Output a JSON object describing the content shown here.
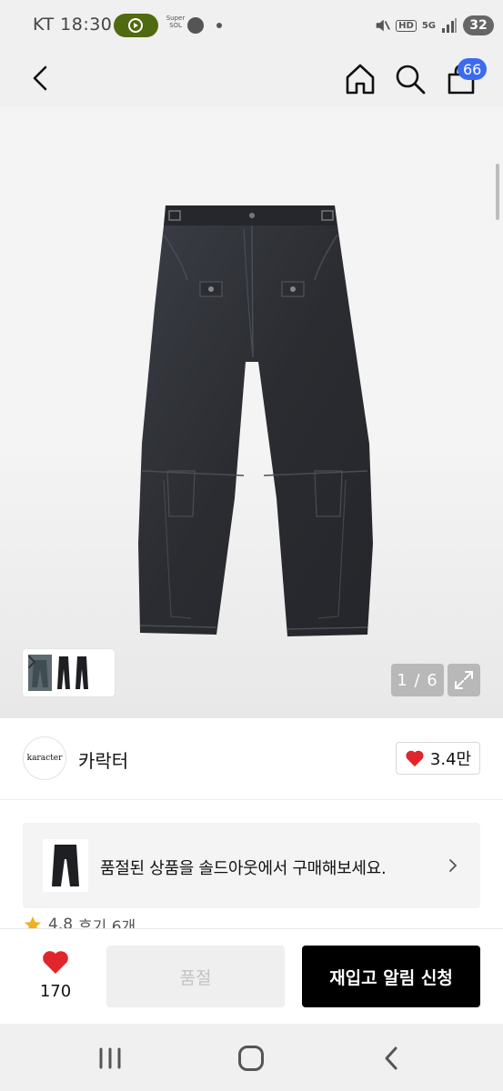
{
  "status_bar": {
    "carrier": "KT",
    "time": "18:30",
    "super_label": "Super SOL",
    "battery": "32",
    "hd_label": "HD",
    "network_label": "5G"
  },
  "header": {
    "cart_count": "66"
  },
  "gallery": {
    "counter": "1 / 6"
  },
  "brand": {
    "logo_text": "karacter",
    "name": "카락터",
    "likes": "3.4만"
  },
  "soldout_banner": {
    "text": "품절된 상품을 솔드아웃에서 구매해보세요."
  },
  "reviews": {
    "rating": "4.8",
    "label": "후기 6개"
  },
  "action_bar": {
    "wish_count": "170",
    "soldout_label": "품절",
    "restock_label": "재입고 알림 신청"
  },
  "colors": {
    "brand_blue": "#3c6bf0",
    "heart_red": "#e0262c",
    "star_gold": "#f2b01e"
  }
}
